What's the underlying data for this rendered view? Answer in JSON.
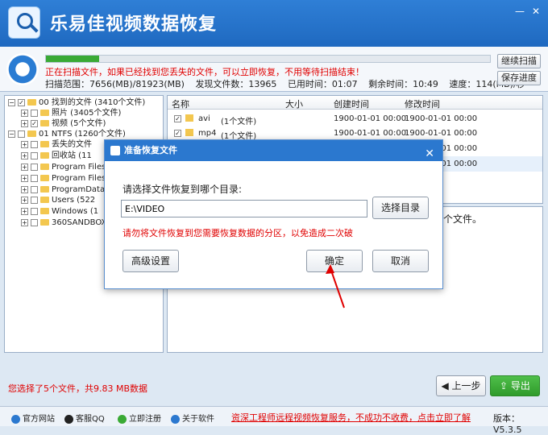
{
  "app": {
    "title": "乐易佳视频数据恢复"
  },
  "window_controls": {
    "minimize": "—",
    "close": "✕"
  },
  "scan": {
    "progress_percent": 12,
    "status": "正在扫描文件，如果已经找到您丢失的文件，可以立即恢复，不用等待扫描结束！",
    "range": "扫描范围：7656(MB)/81923(MB)",
    "found": "发现文件数：13965",
    "elapsed": "已用时间：01:07",
    "remaining": "剩余时间：10:49",
    "speed": "速度：114(MB)/秒",
    "continue_btn": "继续扫描",
    "save_btn": "保存进度"
  },
  "tree": {
    "items": [
      {
        "label": "00  找到的文件    (3410个文件)"
      },
      {
        "label": "照片     (3405个文件)"
      },
      {
        "label": "视频     (5个文件)"
      },
      {
        "label": "01  NTFS      (1260个文件)"
      },
      {
        "label": "丢失的文件"
      },
      {
        "label": "回收站     (11"
      },
      {
        "label": "Program Files"
      },
      {
        "label": "Program Files"
      },
      {
        "label": "ProgramData"
      },
      {
        "label": "Users     (522"
      },
      {
        "label": "Windows     (1"
      },
      {
        "label": "360SANDBOX"
      }
    ]
  },
  "list": {
    "headers": {
      "name": "名称",
      "size": "大小",
      "created": "创建时间",
      "modified": "修改时间"
    },
    "rows": [
      {
        "name": "avi",
        "count": "(1个文件)",
        "created": "1900-01-01  00:00",
        "modified": "1900-01-01  00:00"
      },
      {
        "name": "mp4",
        "count": "(1个文件)",
        "created": "1900-01-01  00:00",
        "modified": "1900-01-01  00:00"
      },
      {
        "name": "",
        "count": "",
        "created": "",
        "modified": "1900-01-01  00:00"
      },
      {
        "name": "",
        "count": "",
        "created": "",
        "modified": "1900-01-01  00:00"
      },
      {
        "name": "",
        "count": "",
        "created": "",
        "modified": "1900-01-01  00:00"
      }
    ]
  },
  "preview": {
    "text": "个文件。"
  },
  "bottom": {
    "selection_info": "您选择了5个文件，共9.83 MB数据",
    "prev_btn": "上一步",
    "export_btn": "导出"
  },
  "footer": {
    "website": "官方网站",
    "qq": "客服QQ",
    "register": "立即注册",
    "about": "关于软件",
    "promo": "资深工程师远程视频恢复服务，不成功不收费，点击立即了解",
    "version": "版本：V5.3.5"
  },
  "dialog": {
    "title": "准备恢复文件",
    "close": "✕",
    "prompt": "请选择文件恢复到哪个目录:",
    "path_value": "E:\\VIDEO",
    "browse_btn": "选择目录",
    "warning": "请勿将文件恢复到您需要恢复数据的分区，以免造成二次破",
    "advanced_btn": "高级设置",
    "ok_btn": "确定",
    "cancel_btn": "取消"
  },
  "colors": {
    "accent": "#2b78cf",
    "warning": "#e00000",
    "success": "#3aaa35"
  }
}
